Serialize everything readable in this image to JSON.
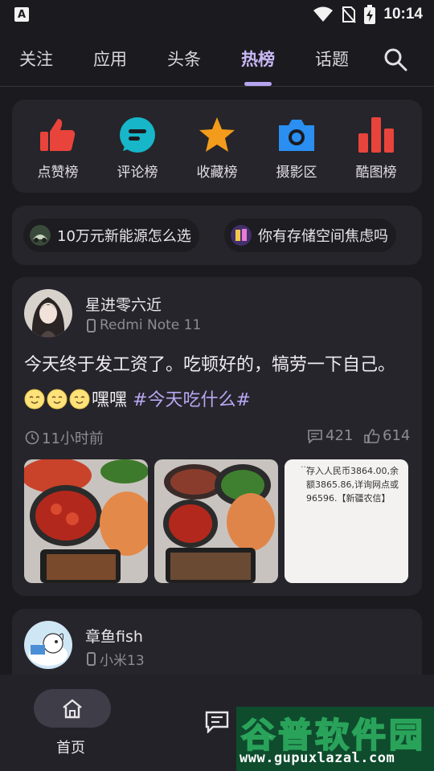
{
  "status_bar": {
    "time": "10:14",
    "carrier_icon": "A"
  },
  "tabs": [
    {
      "label": "关注"
    },
    {
      "label": "应用"
    },
    {
      "label": "头条"
    },
    {
      "label": "热榜",
      "active": true
    },
    {
      "label": "话题"
    }
  ],
  "rank_shortcuts": [
    {
      "label": "点赞榜",
      "icon": "thumbs-up-icon",
      "color": "#e8443b"
    },
    {
      "label": "评论榜",
      "icon": "comment-icon",
      "color": "#17b6c9"
    },
    {
      "label": "收藏榜",
      "icon": "star-icon",
      "color": "#f39b1b"
    },
    {
      "label": "摄影区",
      "icon": "camera-icon",
      "color": "#2a8ff0"
    },
    {
      "label": "酷图榜",
      "icon": "bar-chart-icon",
      "color": "#e8443b"
    }
  ],
  "topics": [
    {
      "label": "10万元新能源怎么选"
    },
    {
      "label": "你有存储空间焦虑吗"
    }
  ],
  "post1": {
    "username": "星进零六近",
    "device": "Redmi Note 11",
    "text": "今天终于发工资了。吃顿好的，犒劳一下自己。",
    "text_suffix": "嘿嘿",
    "hashtag": "#今天吃什么#",
    "time": "11小时前",
    "comments": "421",
    "likes": "614",
    "photo3_lines": [
      "存入人民币3864.00,余",
      "额3865.86,详询网点或",
      "96596.【新疆农信】"
    ]
  },
  "post2": {
    "username": "章鱼fish",
    "device": "小米13"
  },
  "bottom_nav": {
    "home_label": "首页"
  },
  "watermark": {
    "title": "谷普软件园",
    "url": "www.gupuxlazal.com"
  }
}
